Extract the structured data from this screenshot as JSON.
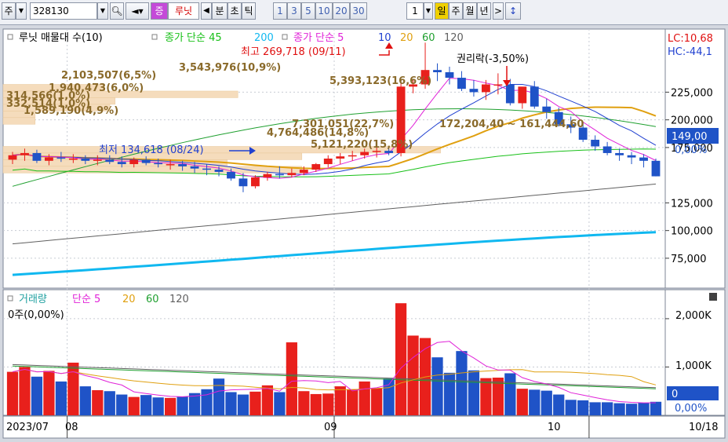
{
  "toolbar": {
    "market": "주",
    "code": "328130",
    "btn_stock": "증",
    "name": "루닛",
    "left_arrow": "◀",
    "unit_min": "분",
    "unit_sec": "초",
    "unit_tick": "틱",
    "periods": [
      "1",
      "3",
      "5",
      "10",
      "20",
      "30"
    ],
    "count": "1",
    "unit_day": "일",
    "unit_week": "주",
    "unit_month": "월",
    "unit_year": "년",
    "right_arrow": ">",
    "updown": "↕"
  },
  "colors": {
    "up": "#e8201c",
    "down": "#1f53c7",
    "ma5": "#e022d8",
    "ma10": "#2040d0",
    "ma20": "#e0a010",
    "ma60": "#20a030",
    "ma120": "#606060",
    "ma200": "#10b8f0",
    "ma45": "#18c018",
    "profile": "#f5dcbc"
  },
  "price_panel": {
    "legend": {
      "title": "루닛 매물대 수(10)",
      "ma_close_simple": "종가 단순 45",
      "p200": "200",
      "ma_close_simple2": "종가 단순 5",
      "p10": "10",
      "p20": "20",
      "p60": "60",
      "p120": "120"
    },
    "lc": "LC:10,68",
    "hc": "HC:-44,1",
    "last_price": "149,00",
    "last_pct": "0,00%",
    "yticks": [
      "225,000",
      "200,000",
      "175,000",
      "125,000",
      "100,000",
      "75,000"
    ],
    "annotations": {
      "high": "최고 269,718 (09/11)",
      "low": "최저 134,618 (08/24)",
      "right_drop": "권리락(-3,50%)",
      "range": "172,204,40 ~ 161,444,60"
    },
    "profile_labels": [
      "3,543,976(10,9%)",
      "2,103,507(6,5%)",
      "1,940,473(6,0%)",
      "314,566(1,0%)",
      "332,514(1,0%)",
      "1,589,190(4,9%)",
      "5,393,123(16,6%)",
      "7,301,051(22,7%)",
      "4,764,486(14,8%)",
      "5,121,220(15,8%)"
    ]
  },
  "volume_panel": {
    "legend": {
      "title": "거래량",
      "ma": "단순 5",
      "p20": "20",
      "p60": "60",
      "p120": "120"
    },
    "sub": "0주(0,00%)",
    "yticks": [
      "2,000K",
      "1,000K"
    ],
    "last_value": "0",
    "last_pct": "0,00%"
  },
  "xaxis": {
    "labels": [
      "2023/07",
      "08",
      "09",
      "10"
    ],
    "last_date": "10/18"
  },
  "chart_data": {
    "type": "candlestick",
    "y_range": [
      48000,
      282000
    ],
    "volume_range_k": [
      0,
      2600
    ],
    "dates": [
      "07/27",
      "07/28",
      "07/31",
      "08/01",
      "08/02",
      "08/03",
      "08/04",
      "08/07",
      "08/08",
      "08/09",
      "08/10",
      "08/11",
      "08/14",
      "08/16",
      "08/17",
      "08/18",
      "08/21",
      "08/22",
      "08/23",
      "08/24",
      "08/25",
      "08/28",
      "08/29",
      "08/30",
      "08/31",
      "09/01",
      "09/04",
      "09/05",
      "09/06",
      "09/07",
      "09/08",
      "09/11",
      "09/12",
      "09/13",
      "09/14",
      "09/15",
      "09/18",
      "09/19",
      "09/20",
      "09/21",
      "09/22",
      "09/25",
      "09/26",
      "09/27",
      "10/04",
      "10/05",
      "10/06",
      "10/10",
      "10/11",
      "10/12",
      "10/13",
      "10/16",
      "10/17",
      "10/18"
    ],
    "open": [
      164000,
      168000,
      170000,
      163000,
      166000,
      165000,
      165000,
      163000,
      164000,
      162000,
      160000,
      164000,
      161000,
      160000,
      160000,
      158000,
      156000,
      155000,
      153000,
      147000,
      140000,
      148000,
      151000,
      150000,
      152000,
      155000,
      160000,
      165000,
      167000,
      168000,
      171000,
      172000,
      170000,
      230000,
      232000,
      245000,
      243000,
      238000,
      228000,
      225000,
      232000,
      232000,
      215000,
      230000,
      212000,
      207000,
      196000,
      193000,
      182000,
      176000,
      170000,
      168000,
      166000,
      163000
    ],
    "high": [
      171000,
      174000,
      173000,
      169000,
      171000,
      169000,
      168000,
      168000,
      168000,
      167000,
      166000,
      167000,
      165000,
      164000,
      163000,
      162000,
      160000,
      158000,
      156000,
      152000,
      150000,
      153000,
      158000,
      156000,
      158000,
      161000,
      168000,
      170000,
      172000,
      174000,
      175000,
      174000,
      236000,
      237000,
      269718,
      251000,
      248000,
      244000,
      236000,
      236000,
      242000,
      237000,
      226000,
      235000,
      219000,
      211000,
      203000,
      197000,
      186000,
      180000,
      174000,
      171000,
      169000,
      165000
    ],
    "low": [
      160000,
      163000,
      161000,
      159000,
      162000,
      161000,
      160000,
      159000,
      160000,
      157000,
      157000,
      159000,
      157000,
      155000,
      154000,
      152000,
      150000,
      149000,
      145000,
      134618,
      138000,
      145000,
      147000,
      148000,
      150000,
      153000,
      157000,
      160000,
      163000,
      165000,
      166000,
      168000,
      167000,
      224000,
      228000,
      235000,
      232000,
      226000,
      221000,
      218000,
      223000,
      213000,
      210000,
      210000,
      201000,
      194000,
      188000,
      180000,
      172000,
      168000,
      163000,
      160000,
      157000,
      149000
    ],
    "close": [
      168000,
      170000,
      163000,
      166000,
      165000,
      165000,
      163000,
      164000,
      162000,
      160000,
      164000,
      161000,
      160000,
      160000,
      158000,
      156000,
      155000,
      153000,
      147000,
      140000,
      148000,
      151000,
      150000,
      152000,
      155000,
      160000,
      165000,
      167000,
      168000,
      171000,
      172000,
      170000,
      230000,
      232000,
      245000,
      243000,
      238000,
      228000,
      225000,
      232000,
      232000,
      215000,
      230000,
      212000,
      207000,
      196000,
      193000,
      182000,
      176000,
      170000,
      168000,
      166000,
      163000,
      149000
    ],
    "volume_k": [
      900,
      1000,
      800,
      920,
      700,
      1090,
      600,
      520,
      500,
      430,
      380,
      420,
      370,
      360,
      390,
      460,
      540,
      760,
      480,
      430,
      490,
      620,
      480,
      1510,
      500,
      440,
      450,
      600,
      540,
      700,
      560,
      760,
      2320,
      1650,
      1600,
      1200,
      880,
      1330,
      930,
      770,
      780,
      870,
      550,
      530,
      510,
      430,
      320,
      310,
      270,
      270,
      250,
      240,
      260,
      280
    ]
  }
}
